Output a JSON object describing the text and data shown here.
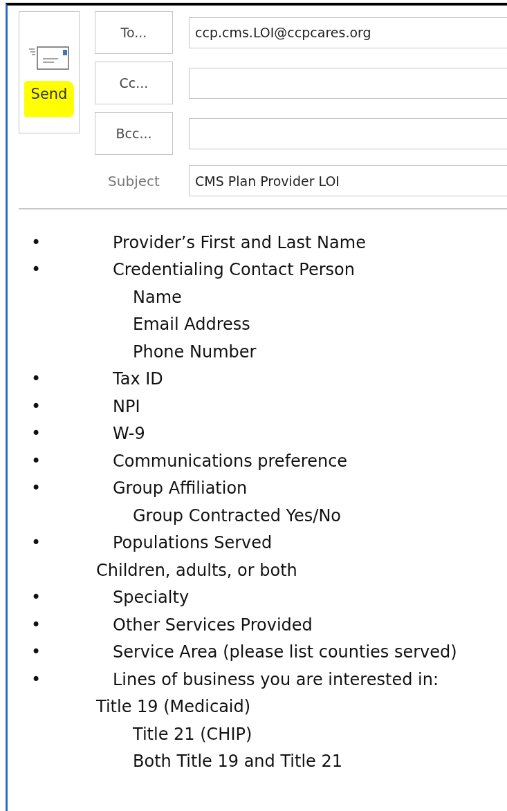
{
  "send_button": {
    "label": "Send",
    "highlighted": true
  },
  "address_rows": [
    {
      "label": "To...",
      "value": "ccp.cms.LOI@ccpcares.org"
    },
    {
      "label": "Cc..."
    },
    {
      "label": "Bcc..."
    }
  ],
  "subject": {
    "label": "Subject",
    "value": "CMS Plan Provider LOI"
  },
  "body_lines": [
    {
      "kind": "bullet",
      "bullet": "•",
      "text": "Provider’s First and Last Name"
    },
    {
      "kind": "bullet",
      "bullet": "•",
      "text": "Credentialing Contact Person"
    },
    {
      "kind": "sub",
      "text": "Name"
    },
    {
      "kind": "sub",
      "text": "Email Address"
    },
    {
      "kind": "sub",
      "text": "Phone Number"
    },
    {
      "kind": "bullet",
      "bullet": "•",
      "text": "Tax ID"
    },
    {
      "kind": "bullet",
      "bullet": "•",
      "text": "NPI"
    },
    {
      "kind": "bullet",
      "bullet": "•",
      "text": "W-9"
    },
    {
      "kind": "bullet",
      "bullet": "•",
      "text": "Communications preference"
    },
    {
      "kind": "bullet",
      "bullet": "•",
      "text": "Group Affiliation"
    },
    {
      "kind": "sub",
      "text": "Group Contracted Yes/No"
    },
    {
      "kind": "bullet",
      "bullet": "•",
      "text": "Populations Served"
    },
    {
      "kind": "plain",
      "text": "Children, adults, or both"
    },
    {
      "kind": "bullet",
      "bullet": "•",
      "text": "Specialty"
    },
    {
      "kind": "bullet",
      "bullet": "•",
      "text": "Other Services Provided"
    },
    {
      "kind": "bullet",
      "bullet": "•",
      "text": "Service Area (please list counties served)"
    },
    {
      "kind": "bullet",
      "bullet": "•",
      "text": "Lines of business you are interested in:"
    },
    {
      "kind": "plain",
      "text": "Title 19 (Medicaid)"
    },
    {
      "kind": "sub",
      "text": "Title 21 (CHIP)"
    },
    {
      "kind": "sub",
      "text": "Both Title 19 and Title 21"
    }
  ]
}
